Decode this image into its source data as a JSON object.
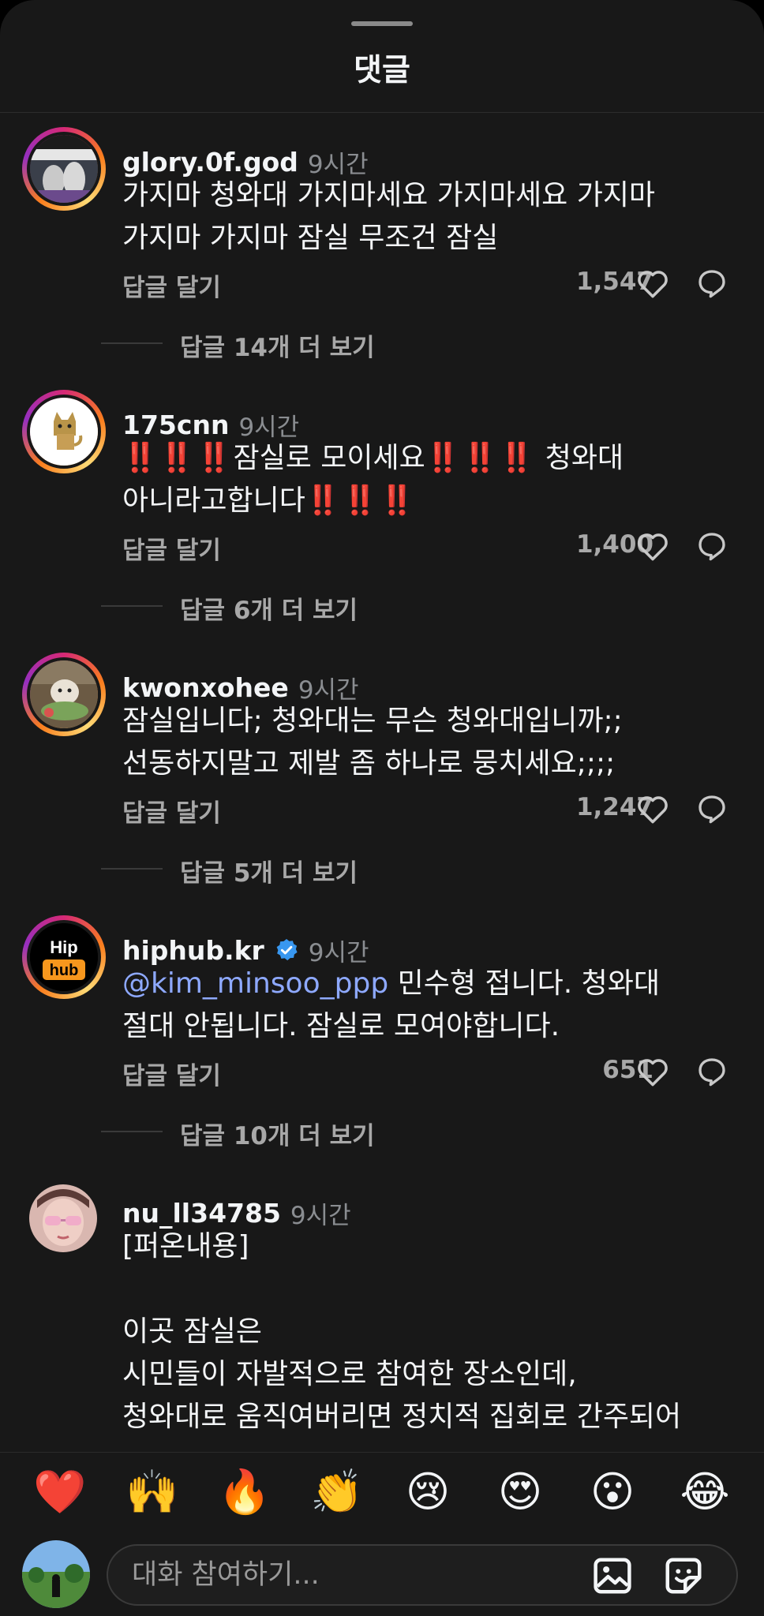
{
  "sheet": {
    "title": "댓글"
  },
  "comments": [
    {
      "username": "glory.0f.god",
      "time": "9시간",
      "text": "가지마 청와대 가지마세요 가지마세요 가지마\n가지마 가지마 잠실 무조건 잠실",
      "reply_label": "답글 달기",
      "likes": "1,547",
      "view_replies": "답글 14개 더 보기"
    },
    {
      "username": "175cnn",
      "time": "9시간",
      "text_line1_a": "잠실로 모이세요",
      "text_line1_b": " 청와대",
      "text_line2": "아니라고합니다",
      "emphasis": "‼️‼️‼️",
      "reply_label": "답글 달기",
      "likes": "1,400",
      "view_replies": "답글 6개 더 보기"
    },
    {
      "username": "kwonxohee",
      "time": "9시간",
      "text": "잠실입니다; 청와대는 무슨 청와대입니까;;\n선동하지말고 제발 좀 하나로 뭉치세요;;;;",
      "reply_label": "답글 달기",
      "likes": "1,247",
      "view_replies": "답글 5개 더 보기"
    },
    {
      "username": "hiphub.kr",
      "time": "9시간",
      "mention": "@kim_minsoo_ppp",
      "text_after_mention": " 민수형 접니다. 청와대\n절대 안됩니다. 잠실로 모여야합니다.",
      "avatar_text_top": "Hip",
      "avatar_text_bottom": "hub",
      "reply_label": "답글 달기",
      "likes": "651",
      "view_replies": "답글 10개 더 보기"
    },
    {
      "username": "nu_ll34785",
      "time": "9시간",
      "text": "[퍼온내용]\n\n이곳 잠실은\n시민들이 자발적으로 참여한 장소인데,\n청와대로 움직여버리면 정치적 집회로 간주되어"
    }
  ],
  "reactions": [
    "❤️",
    "🙌",
    "🔥",
    "👏",
    "😢",
    "😍",
    "😮",
    "😂"
  ],
  "composer": {
    "placeholder": "대화 참여하기..."
  },
  "colors": {
    "background": "#181818",
    "mention": "#8ea9ff",
    "verified": "#3897f0",
    "muted": "#a8a8a8"
  }
}
